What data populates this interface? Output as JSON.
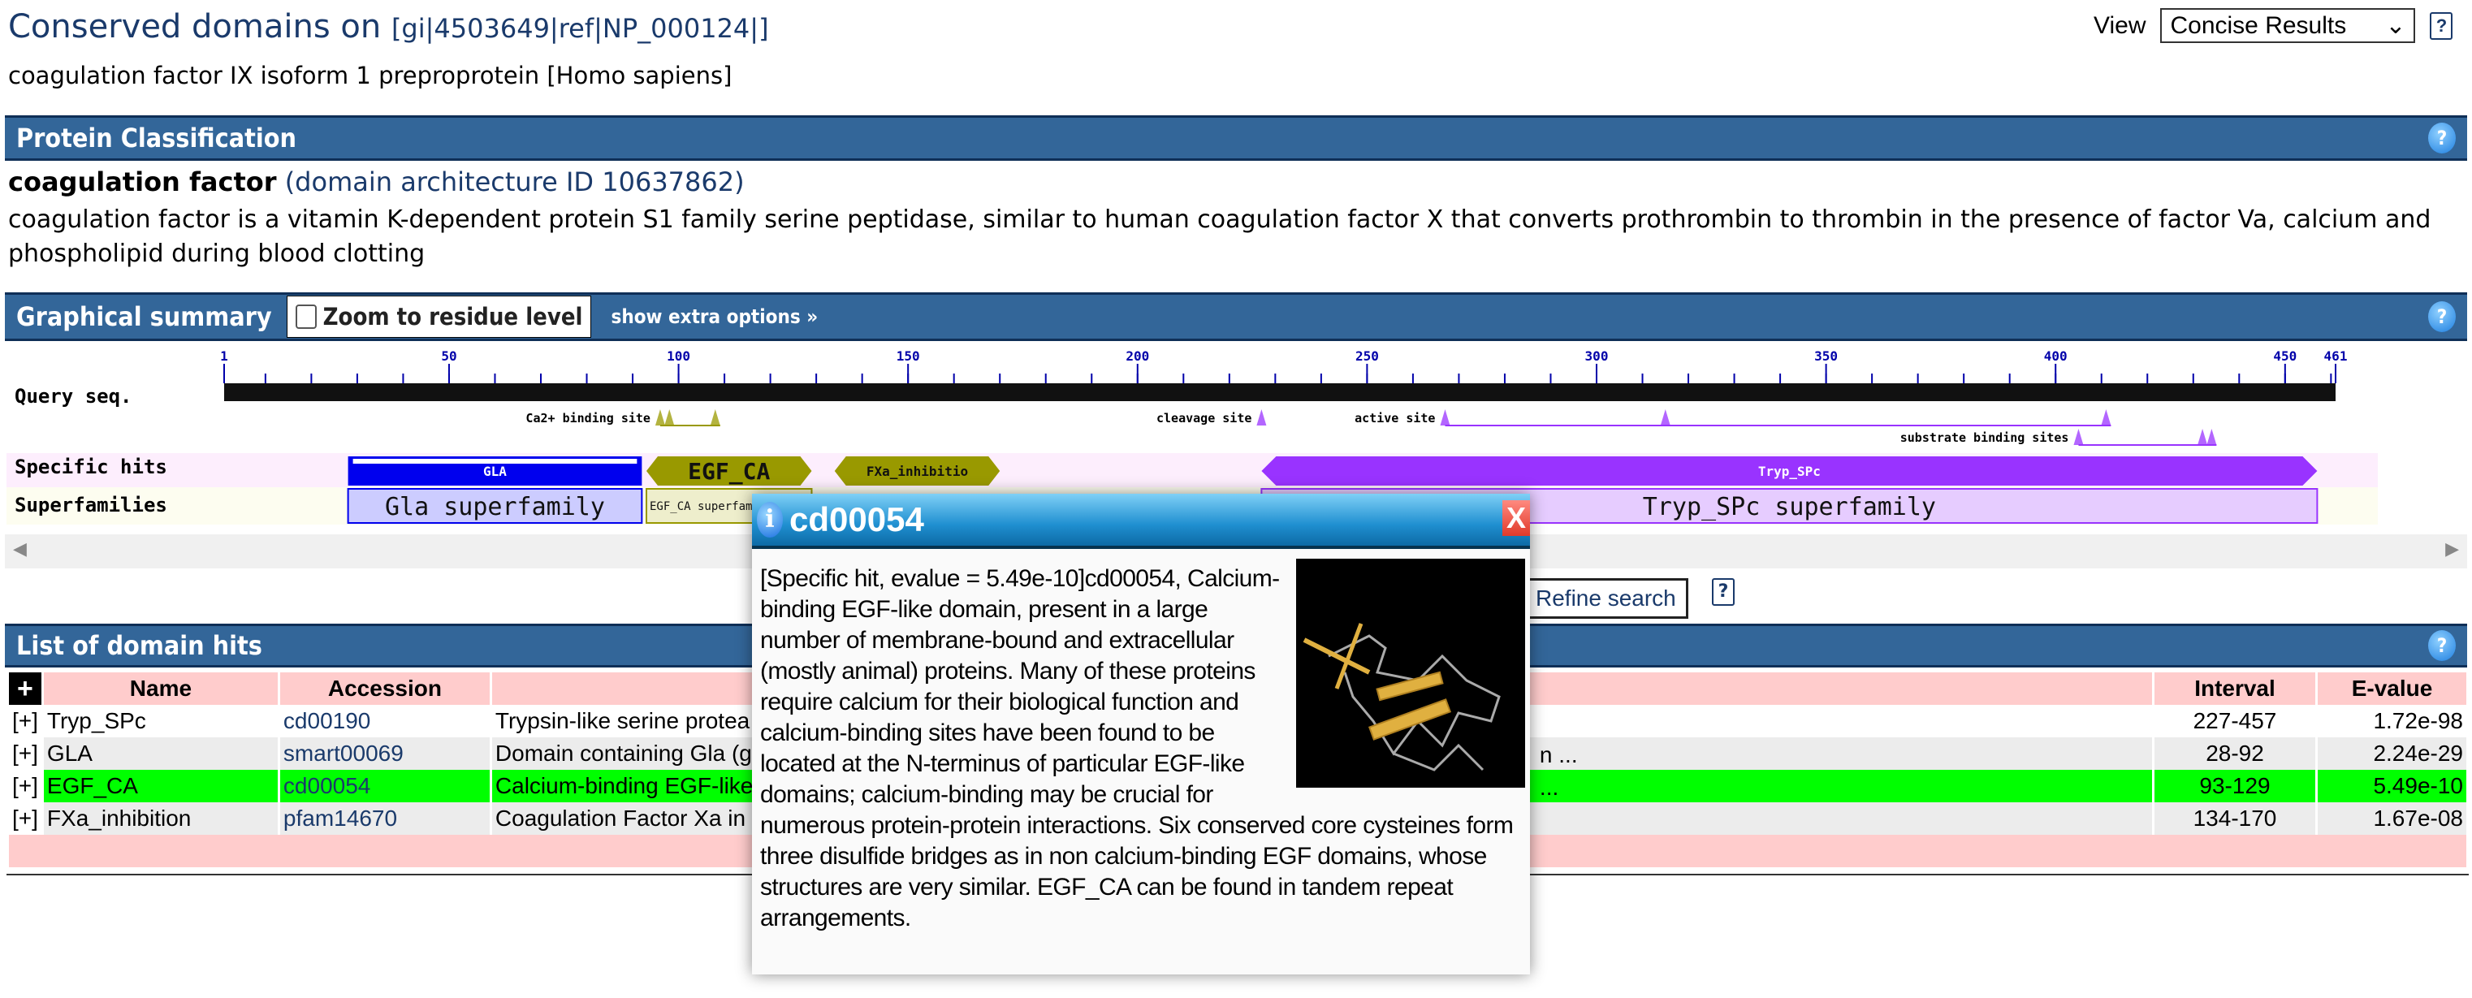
{
  "header": {
    "title": "Conserved domains on",
    "query_id": "[gi|4503649|ref|NP_000124|]",
    "subtitle": "coagulation factor IX isoform 1 preproprotein [Homo sapiens]",
    "view_label": "View",
    "view_selected": "Concise Results",
    "help_label": "?"
  },
  "classification": {
    "bar_title": "Protein Classification",
    "name": "coagulation factor",
    "arch_id": "(domain architecture ID 10637862)",
    "description": "coagulation factor is a vitamin K-dependent protein S1 family serine peptidase, similar to human coagulation factor X that converts prothrombin to thrombin in the presence of factor Va, calcium and phospholipid during blood clotting"
  },
  "graphical": {
    "bar_title": "Graphical summary",
    "zoom_label": "Zoom to residue level",
    "zoom_checked": false,
    "extra_options": "show extra options »",
    "query_label": "Query seq.",
    "specific_label": "Specific hits",
    "superfamilies_label": "Superfamilies",
    "seq_length": 461,
    "ticks": [
      1,
      50,
      100,
      150,
      200,
      250,
      300,
      350,
      400,
      450,
      461
    ],
    "sites": [
      {
        "label": "Ca2+ binding site",
        "residues": [
          96,
          98,
          108
        ],
        "color": "#999900",
        "row": 0
      },
      {
        "label": "cleavage site",
        "residues": [
          227
        ],
        "color": "#9933ff",
        "row": 0
      },
      {
        "label": "active site",
        "residues": [
          267,
          315,
          411
        ],
        "color": "#9933ff",
        "row": 0
      },
      {
        "label": "substrate binding sites",
        "residues": [
          405,
          432,
          434
        ],
        "color": "#9933ff",
        "row": 1
      }
    ],
    "specific_hits": [
      {
        "label": "GLA",
        "start": 28,
        "end": 92,
        "color": "#0000ee",
        "shape": "rect"
      },
      {
        "label": "EGF_CA",
        "start": 93,
        "end": 129,
        "color": "#999900",
        "shape": "hex"
      },
      {
        "label": "FXa_inhibitio",
        "start": 134,
        "end": 170,
        "color": "#999900",
        "shape": "hex"
      },
      {
        "label": "Tryp_SPc",
        "start": 227,
        "end": 457,
        "color": "#9933ff",
        "shape": "arrow"
      }
    ],
    "superfamilies": [
      {
        "label": "Gla superfamily",
        "start": 28,
        "end": 92,
        "color": "#ccccff",
        "border": "#0000ee"
      },
      {
        "label": "EGF_CA superfamily",
        "start": 93,
        "end": 129,
        "color": "#eeeecc",
        "border": "#999900"
      },
      {
        "label": "Tryp_SPc superfamily",
        "start": 227,
        "end": 457,
        "color": "#e6ccff",
        "border": "#9933ff"
      }
    ],
    "refine_label": "Refine search"
  },
  "hits": {
    "bar_title": "List of domain hits",
    "columns": [
      "Name",
      "Accession",
      "Interval",
      "E-value"
    ],
    "rows": [
      {
        "name": "Tryp_SPc",
        "accession": "cd00190",
        "description": "Trypsin-like serine protea",
        "tail": "",
        "interval": "227-457",
        "evalue": "1.72e-98"
      },
      {
        "name": "GLA",
        "accession": "smart00069",
        "description": "Domain containing Gla (g",
        "tail": "n ...",
        "interval": "28-92",
        "evalue": "2.24e-29"
      },
      {
        "name": "EGF_CA",
        "accession": "cd00054",
        "description": "Calcium-binding EGF-like",
        "tail": "...",
        "interval": "93-129",
        "evalue": "5.49e-10"
      },
      {
        "name": "FXa_inhibition",
        "accession": "pfam14670",
        "description": "Coagulation Factor Xa in",
        "tail": "",
        "interval": "134-170",
        "evalue": "1.67e-08"
      }
    ],
    "expand_label": "[+]",
    "highlight_color": "#00ff00"
  },
  "popup": {
    "title": "cd00054",
    "text": "[Specific hit, evalue = 5.49e-10]cd00054, Calcium-binding EGF-like domain, present in a large number of membrane-bound and extracellular (mostly animal) proteins. Many of these proteins require calcium for their biological function and calcium-binding sites have been found to be located at the N-terminus of particular EGF-like domains; calcium-binding may be crucial for numerous protein-protein interactions. Six conserved core cysteines form three disulfide bridges as in non calcium-binding EGF domains, whose structures are very similar. EGF_CA can be found in tandem repeat arrangements.",
    "close_label": "X"
  }
}
